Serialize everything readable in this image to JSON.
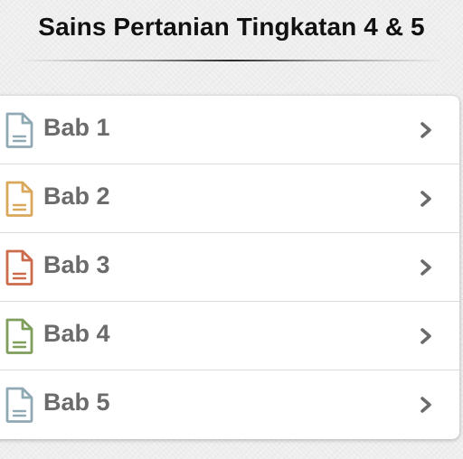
{
  "header": {
    "title": "Sains Pertanian Tingkatan 4 & 5"
  },
  "chapters": [
    {
      "label": "Bab 1",
      "icon": "document-icon",
      "icon_color": "#8fa9b5"
    },
    {
      "label": "Bab 2",
      "icon": "document-icon",
      "icon_color": "#d9a85a"
    },
    {
      "label": "Bab 3",
      "icon": "document-icon",
      "icon_color": "#cc6a4c"
    },
    {
      "label": "Bab 4",
      "icon": "document-icon",
      "icon_color": "#7f9e5b"
    },
    {
      "label": "Bab 5",
      "icon": "document-icon",
      "icon_color": "#8fa9b5"
    }
  ],
  "colors": {
    "chevron": "#6b6b6b",
    "label": "#6b6b6b"
  }
}
